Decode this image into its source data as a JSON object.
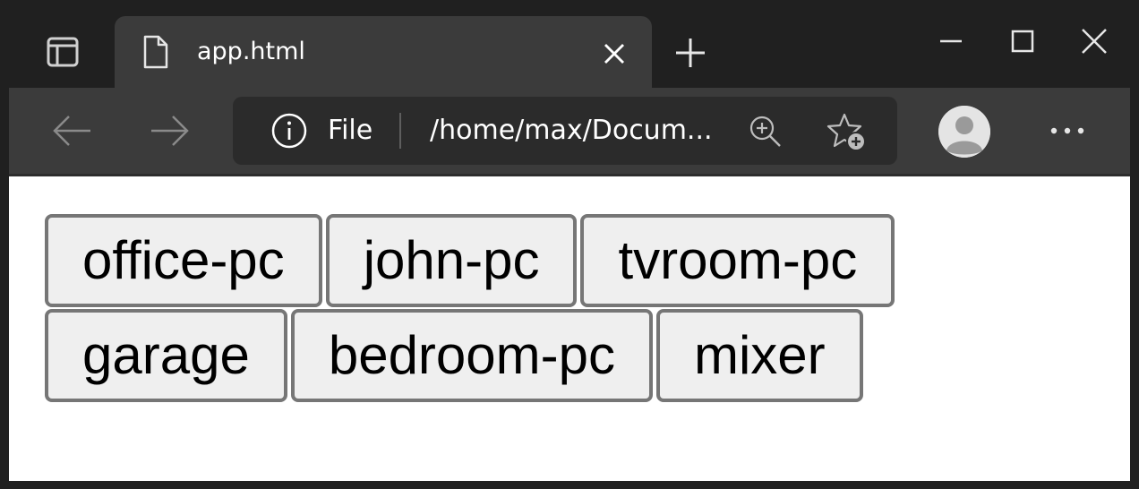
{
  "browser": {
    "tab": {
      "title": "app.html"
    },
    "address_bar": {
      "scheme_label": "File",
      "url": "/home/max/Docum..."
    },
    "icons": {
      "tab_actions": "tab-actions-icon",
      "page": "page-icon",
      "close": "close-icon",
      "new_tab": "plus-icon",
      "back": "back-arrow-icon",
      "forward": "forward-arrow-icon",
      "info": "info-icon",
      "zoom": "zoom-in-icon",
      "favorite": "add-favorite-icon",
      "profile": "profile-avatar",
      "more": "more-dots-icon"
    },
    "colors": {
      "tabstrip": "#202020",
      "toolbar": "#3b3b3b",
      "addressbar": "#2b2b2b",
      "content": "#ffffff"
    }
  },
  "page": {
    "buttons_row_1": [
      {
        "label": "office-pc"
      },
      {
        "label": "john-pc"
      },
      {
        "label": "tvroom-pc"
      }
    ],
    "buttons_row_2": [
      {
        "label": "garage"
      },
      {
        "label": "bedroom-pc"
      },
      {
        "label": "mixer"
      }
    ],
    "button_colors": {
      "background": "#efefef",
      "border": "#767676"
    }
  }
}
